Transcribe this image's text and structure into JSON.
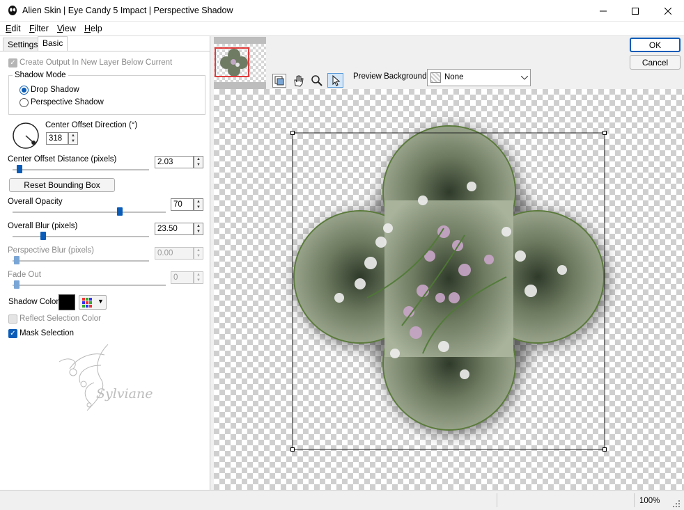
{
  "window": {
    "title": "Alien Skin | Eye Candy 5 Impact | Perspective Shadow"
  },
  "menu": [
    {
      "label": "Edit",
      "u": "E",
      "rest": "dit"
    },
    {
      "label": "Filter",
      "u": "F",
      "rest": "ilter"
    },
    {
      "label": "View",
      "u": "V",
      "rest": "iew"
    },
    {
      "label": "Help",
      "u": "H",
      "rest": "elp"
    }
  ],
  "tabs": {
    "settings": "Settings",
    "basic": "Basic"
  },
  "panel": {
    "create_output": "Create Output In New Layer Below Current",
    "shadow_mode_title": "Shadow Mode",
    "drop_shadow": "Drop Shadow",
    "perspective_shadow": "Perspective Shadow",
    "center_offset_direction_label": "Center Offset Direction (°)",
    "center_offset_direction_value": "318",
    "center_offset_direction_degrees": 318,
    "center_offset_distance_label": "Center Offset Distance (pixels)",
    "center_offset_distance_value": "2.03",
    "center_offset_distance_level": 0.02,
    "reset_bounding_box": "Reset Bounding Box",
    "overall_opacity_label": "Overall Opacity",
    "overall_opacity_value": "70",
    "overall_opacity_level": 0.7,
    "overall_blur_label": "Overall Blur (pixels)",
    "overall_blur_value": "23.50",
    "overall_blur_level": 0.2,
    "perspective_blur_label": "Perspective Blur (pixels)",
    "perspective_blur_value": "0.00",
    "perspective_blur_level": 0.0,
    "fade_out_label": "Fade Out",
    "fade_out_value": "0",
    "fade_out_level": 0.0,
    "shadow_color_label": "Shadow Color",
    "shadow_color": "#000000",
    "reflect_selection_color": "Reflect Selection Color",
    "mask_selection": "Mask Selection",
    "watermark_text": "Sylviane"
  },
  "toolbar": {
    "preview_background_label": "Preview Background:",
    "preview_background_value": "None"
  },
  "buttons": {
    "ok": "OK",
    "cancel": "Cancel"
  },
  "status": {
    "zoom": "100%"
  },
  "colors": {
    "accent": "#0a5cb8",
    "navigator_frame": "#e03c3c"
  }
}
